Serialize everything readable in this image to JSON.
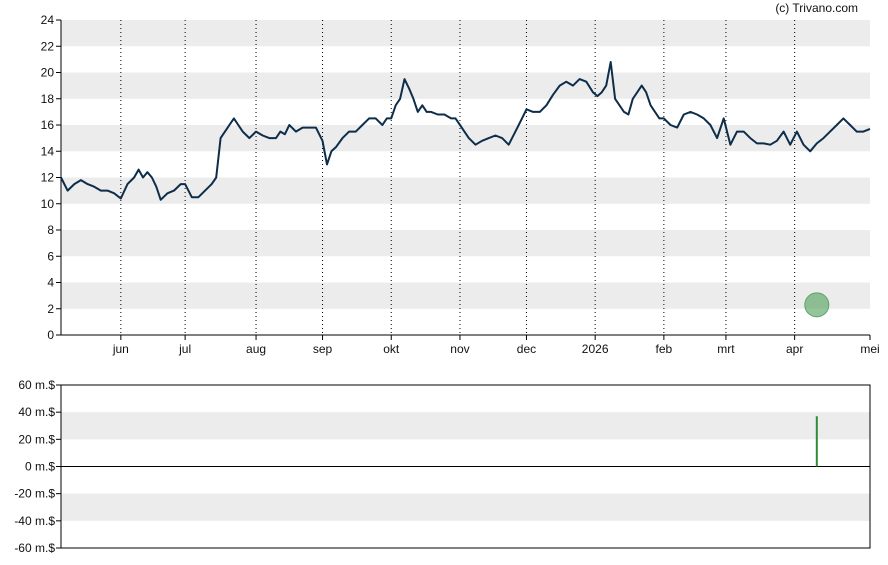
{
  "credit": "(c) Trivano.com",
  "colors": {
    "price_line": "#0d2d4a",
    "band": "#ececec",
    "marker": "#5aa564",
    "volume": "#2e8b3a",
    "axis": "#000000"
  },
  "chart_data": [
    {
      "type": "line",
      "title": "",
      "xlabel": "",
      "ylabel": "",
      "ylim": [
        0,
        24
      ],
      "yticks": [
        0,
        2,
        4,
        6,
        8,
        10,
        12,
        14,
        16,
        18,
        20,
        22,
        24
      ],
      "grid": "dotted vertical lines at month ticks, alternating horizontal bands",
      "xlim": [
        0,
        365
      ],
      "xtick_labels": [
        {
          "label": "jun",
          "x": 27
        },
        {
          "label": "jul",
          "x": 56
        },
        {
          "label": "aug",
          "x": 88
        },
        {
          "label": "sep",
          "x": 118
        },
        {
          "label": "okt",
          "x": 149
        },
        {
          "label": "nov",
          "x": 180
        },
        {
          "label": "dec",
          "x": 210
        },
        {
          "label": "2026",
          "x": 241
        },
        {
          "label": "feb",
          "x": 272
        },
        {
          "label": "mrt",
          "x": 300
        },
        {
          "label": "apr",
          "x": 331
        },
        {
          "label": "mei",
          "x": 365
        }
      ],
      "series": [
        {
          "points": [
            [
              0,
              12.0
            ],
            [
              3,
              11.0
            ],
            [
              6,
              11.5
            ],
            [
              9,
              11.8
            ],
            [
              12,
              11.5
            ],
            [
              15,
              11.3
            ],
            [
              18,
              11.0
            ],
            [
              21,
              11.0
            ],
            [
              24,
              10.8
            ],
            [
              27,
              10.4
            ],
            [
              30,
              11.5
            ],
            [
              33,
              12.0
            ],
            [
              35,
              12.6
            ],
            [
              37,
              12.0
            ],
            [
              39,
              12.4
            ],
            [
              41,
              12.0
            ],
            [
              43,
              11.3
            ],
            [
              45,
              10.3
            ],
            [
              48,
              10.8
            ],
            [
              51,
              11.0
            ],
            [
              54,
              11.5
            ],
            [
              56,
              11.5
            ],
            [
              59,
              10.5
            ],
            [
              62,
              10.5
            ],
            [
              65,
              11.0
            ],
            [
              68,
              11.5
            ],
            [
              70,
              12.0
            ],
            [
              72,
              15.0
            ],
            [
              74,
              15.5
            ],
            [
              76,
              16.0
            ],
            [
              78,
              16.5
            ],
            [
              80,
              16.0
            ],
            [
              82,
              15.5
            ],
            [
              85,
              15.0
            ],
            [
              88,
              15.5
            ],
            [
              91,
              15.2
            ],
            [
              94,
              15.0
            ],
            [
              97,
              15.0
            ],
            [
              99,
              15.5
            ],
            [
              101,
              15.3
            ],
            [
              103,
              16.0
            ],
            [
              106,
              15.5
            ],
            [
              109,
              15.8
            ],
            [
              112,
              15.8
            ],
            [
              115,
              15.8
            ],
            [
              118,
              14.8
            ],
            [
              120,
              13.0
            ],
            [
              122,
              14.0
            ],
            [
              124,
              14.3
            ],
            [
              127,
              15.0
            ],
            [
              130,
              15.5
            ],
            [
              133,
              15.5
            ],
            [
              136,
              16.0
            ],
            [
              139,
              16.5
            ],
            [
              142,
              16.5
            ],
            [
              145,
              16.0
            ],
            [
              147,
              16.5
            ],
            [
              149,
              16.5
            ],
            [
              151,
              17.5
            ],
            [
              153,
              18.0
            ],
            [
              155,
              19.5
            ],
            [
              157,
              18.8
            ],
            [
              159,
              18.0
            ],
            [
              161,
              17.0
            ],
            [
              163,
              17.5
            ],
            [
              165,
              17.0
            ],
            [
              167,
              17.0
            ],
            [
              170,
              16.8
            ],
            [
              173,
              16.8
            ],
            [
              176,
              16.5
            ],
            [
              178,
              16.5
            ],
            [
              180,
              16.0
            ],
            [
              182,
              15.5
            ],
            [
              184,
              15.0
            ],
            [
              187,
              14.5
            ],
            [
              190,
              14.8
            ],
            [
              193,
              15.0
            ],
            [
              196,
              15.2
            ],
            [
              199,
              15.0
            ],
            [
              202,
              14.5
            ],
            [
              205,
              15.5
            ],
            [
              208,
              16.5
            ],
            [
              210,
              17.2
            ],
            [
              213,
              17.0
            ],
            [
              216,
              17.0
            ],
            [
              219,
              17.5
            ],
            [
              222,
              18.3
            ],
            [
              225,
              19.0
            ],
            [
              228,
              19.3
            ],
            [
              231,
              19.0
            ],
            [
              234,
              19.5
            ],
            [
              237,
              19.3
            ],
            [
              240,
              18.5
            ],
            [
              242,
              18.2
            ],
            [
              244,
              18.5
            ],
            [
              246,
              19.0
            ],
            [
              248,
              20.8
            ],
            [
              250,
              18.0
            ],
            [
              252,
              17.5
            ],
            [
              254,
              17.0
            ],
            [
              256,
              16.8
            ],
            [
              258,
              18.0
            ],
            [
              260,
              18.5
            ],
            [
              262,
              19.0
            ],
            [
              264,
              18.5
            ],
            [
              266,
              17.5
            ],
            [
              268,
              17.0
            ],
            [
              270,
              16.5
            ],
            [
              272,
              16.5
            ],
            [
              275,
              16.0
            ],
            [
              278,
              15.8
            ],
            [
              281,
              16.8
            ],
            [
              284,
              17.0
            ],
            [
              287,
              16.8
            ],
            [
              290,
              16.5
            ],
            [
              293,
              16.0
            ],
            [
              296,
              15.0
            ],
            [
              299,
              16.5
            ],
            [
              302,
              14.5
            ],
            [
              305,
              15.5
            ],
            [
              308,
              15.5
            ],
            [
              311,
              15.0
            ],
            [
              314,
              14.6
            ],
            [
              317,
              14.6
            ],
            [
              320,
              14.5
            ],
            [
              323,
              14.8
            ],
            [
              326,
              15.5
            ],
            [
              329,
              14.5
            ],
            [
              332,
              15.5
            ],
            [
              335,
              14.5
            ],
            [
              338,
              14.0
            ],
            [
              341,
              14.6
            ],
            [
              344,
              15.0
            ],
            [
              347,
              15.5
            ],
            [
              350,
              16.0
            ],
            [
              353,
              16.5
            ],
            [
              356,
              16.0
            ],
            [
              359,
              15.5
            ],
            [
              362,
              15.5
            ],
            [
              365,
              15.7
            ]
          ]
        }
      ],
      "markers": [
        {
          "x": 341,
          "y": 2.3,
          "shape": "circle"
        }
      ]
    },
    {
      "type": "bar",
      "title": "",
      "xlabel": "",
      "ylabel": "",
      "ylim": [
        -60,
        60
      ],
      "ytick_labels": [
        "60 m.$",
        "40 m.$",
        "20 m.$",
        "0 m.$",
        "-20 m.$",
        "-40 m.$",
        "-60 m.$"
      ],
      "yticks": [
        60,
        40,
        20,
        0,
        -20,
        -40,
        -60
      ],
      "xlim": [
        0,
        365
      ],
      "bars": [
        {
          "x": 341,
          "value": 37
        }
      ]
    }
  ]
}
